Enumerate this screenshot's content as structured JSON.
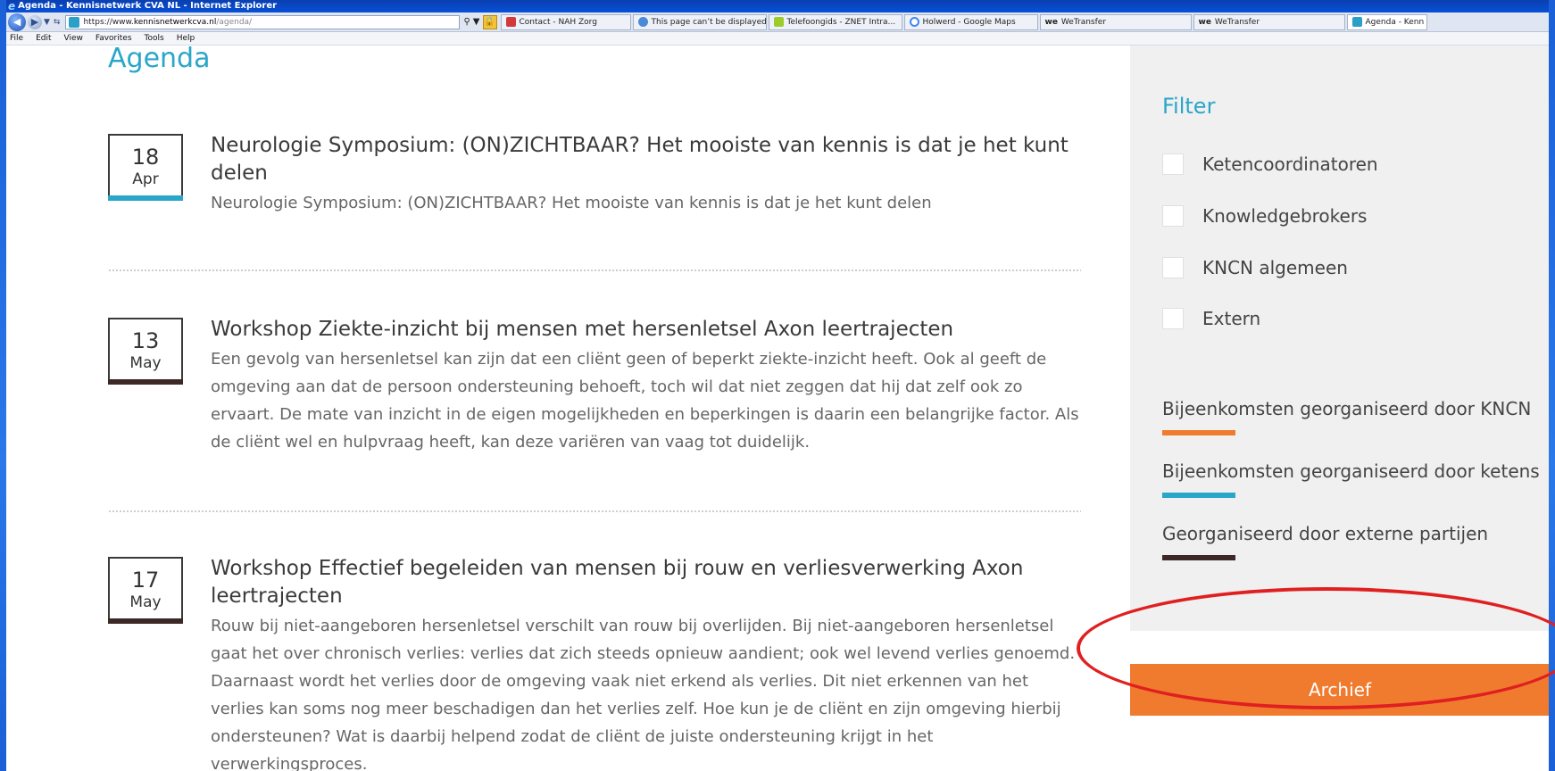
{
  "window": {
    "title": "Agenda - Kennisnetwerk CVA NL - Internet Explorer",
    "address_secure": "https://www.",
    "address_host": "kennisnetwerkcva.nl",
    "address_path": "/agenda/"
  },
  "tabs": [
    {
      "label": "Contact - NAH Zorg",
      "color": "#d23a3a"
    },
    {
      "label": "This page can’t be displayed",
      "color": "#4a8ad8"
    },
    {
      "label": "Telefoongids - ZNET Intra...",
      "color": "#9ccc2a"
    },
    {
      "label": "Holwerd - Google Maps",
      "color": "#4285f4"
    },
    {
      "label": "WeTransfer",
      "color": "#222222"
    },
    {
      "label": "WeTransfer",
      "color": "#222222"
    },
    {
      "label": "Agenda - Kenn",
      "color": "#2aa0c8"
    }
  ],
  "menu": [
    "File",
    "Edit",
    "View",
    "Favorites",
    "Tools",
    "Help"
  ],
  "page": {
    "title": "Agenda"
  },
  "events": [
    {
      "day": "18",
      "month": "Apr",
      "bar_color": "#2aa6c8",
      "title": "Neurologie Symposium: (ON)ZICHTBAAR? Het mooiste van kennis is dat je het kunt delen",
      "description": "Neurologie Symposium: (ON)ZICHTBAAR? Het mooiste van kennis is dat je het kunt delen"
    },
    {
      "day": "13",
      "month": "May",
      "bar_color": "#3d2828",
      "title": "Workshop Ziekte-inzicht bij mensen met hersenletsel Axon leertrajecten",
      "description": "Een gevolg van hersenletsel kan zijn dat een cliënt geen of beperkt ziekte-inzicht heeft. Ook al geeft de omgeving aan dat de persoon ondersteuning behoeft, toch wil dat niet zeggen dat hij dat zelf ook zo ervaart. De mate van inzicht in de eigen mogelijkheden en beperkingen is daarin een belangrijke factor. Als de cliënt wel en hulpvraag heeft, kan deze variëren van vaag tot duidelijk."
    },
    {
      "day": "17",
      "month": "May",
      "bar_color": "#3d2828",
      "title": "Workshop Effectief begeleiden van mensen bij rouw en verliesverwerking Axon leertrajecten",
      "description": "Rouw bij niet-aangeboren hersenletsel verschilt van rouw bij overlijden. Bij niet-aangeboren hersenletsel gaat het over chronisch verlies: verlies dat zich steeds opnieuw aandient; ook wel levend verlies genoemd. Daarnaast wordt het verlies door de omgeving vaak niet erkend als verlies. Dit niet erkennen van het verlies kan soms nog meer beschadigen dan het verlies zelf. Hoe kun je de cliënt en zijn omgeving hierbij ondersteunen? Wat is daarbij helpend zodat de cliënt de juiste ondersteuning krijgt in het verwerkingsproces."
    }
  ],
  "sidebar": {
    "filter_title": "Filter",
    "filters": [
      "Ketencoordinatoren",
      "Knowledgebrokers",
      "KNCN algemeen",
      "Extern"
    ],
    "legend": [
      {
        "label": "Bijeenkomsten georganiseerd door KNCN",
        "color": "#f07b2e"
      },
      {
        "label": "Bijeenkomsten georganiseerd door ketens",
        "color": "#2aa6c8"
      },
      {
        "label": "Georganiseerd door externe partijen",
        "color": "#3d2828"
      }
    ],
    "archive_button": "Archief"
  },
  "colors": {
    "accent": "#2aa6c8",
    "orange": "#f07b2e",
    "annotation_circle": "#e02020"
  }
}
